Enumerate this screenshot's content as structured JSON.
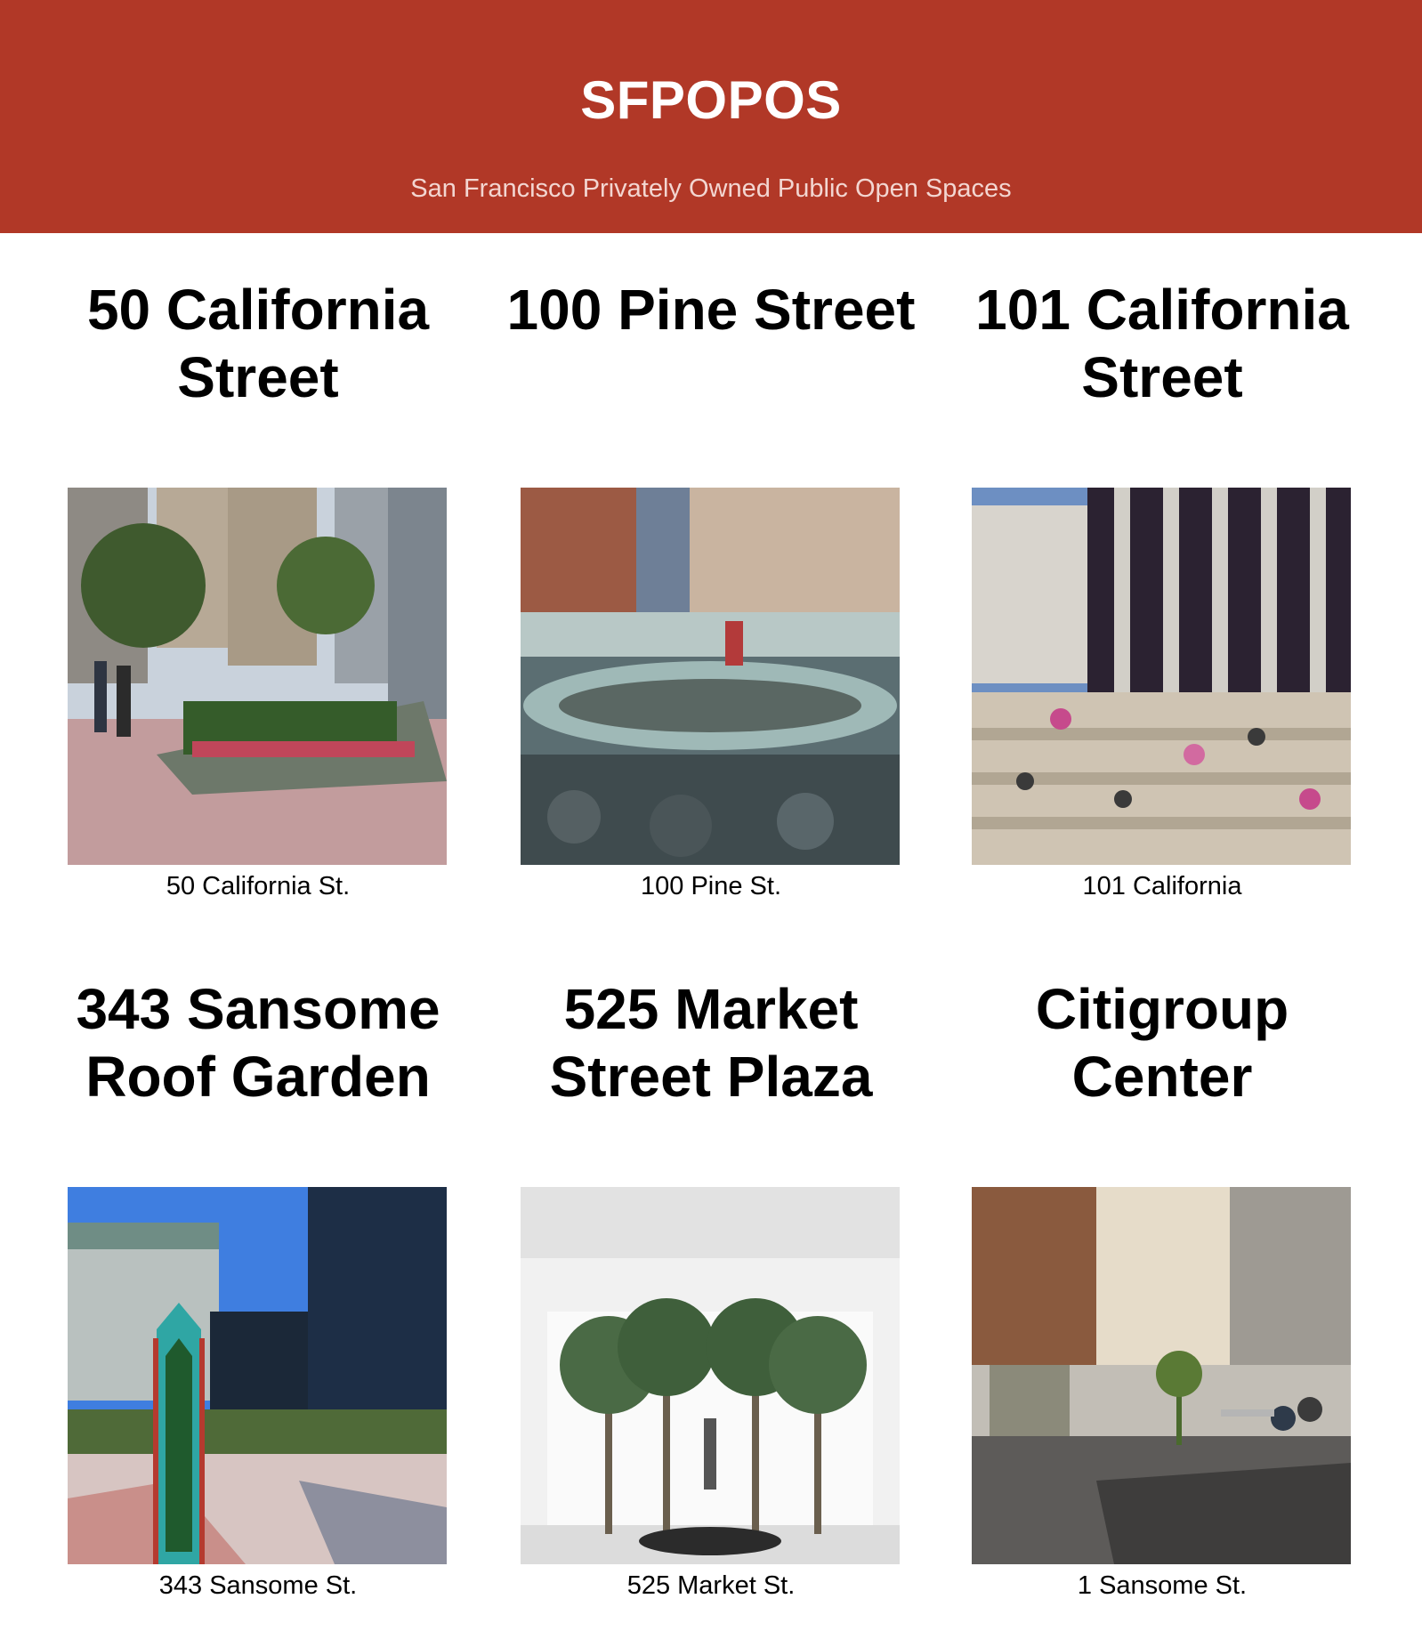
{
  "header": {
    "title": "SFPOPOS",
    "subtitle": "San Francisco Privately Owned Public Open Spaces"
  },
  "places": [
    {
      "title": "50 California Street",
      "caption": "50 California St.",
      "photo": "plaza-trees-photo"
    },
    {
      "title": "100 Pine Street",
      "caption": "100 Pine St.",
      "photo": "water-feature-photo"
    },
    {
      "title": "101 California Street",
      "caption": "101 California",
      "photo": "stepped-plaza-photo"
    },
    {
      "title": "343 Sansome Roof Garden",
      "caption": "343 Sansome St.",
      "photo": "roof-garden-obelisk-photo"
    },
    {
      "title": "525 Market Street Plaza",
      "caption": "525 Market St.",
      "photo": "atrium-palms-photo"
    },
    {
      "title": "Citigroup Center",
      "caption": "1 Sansome St.",
      "photo": "courtyard-fountain-photo"
    }
  ]
}
